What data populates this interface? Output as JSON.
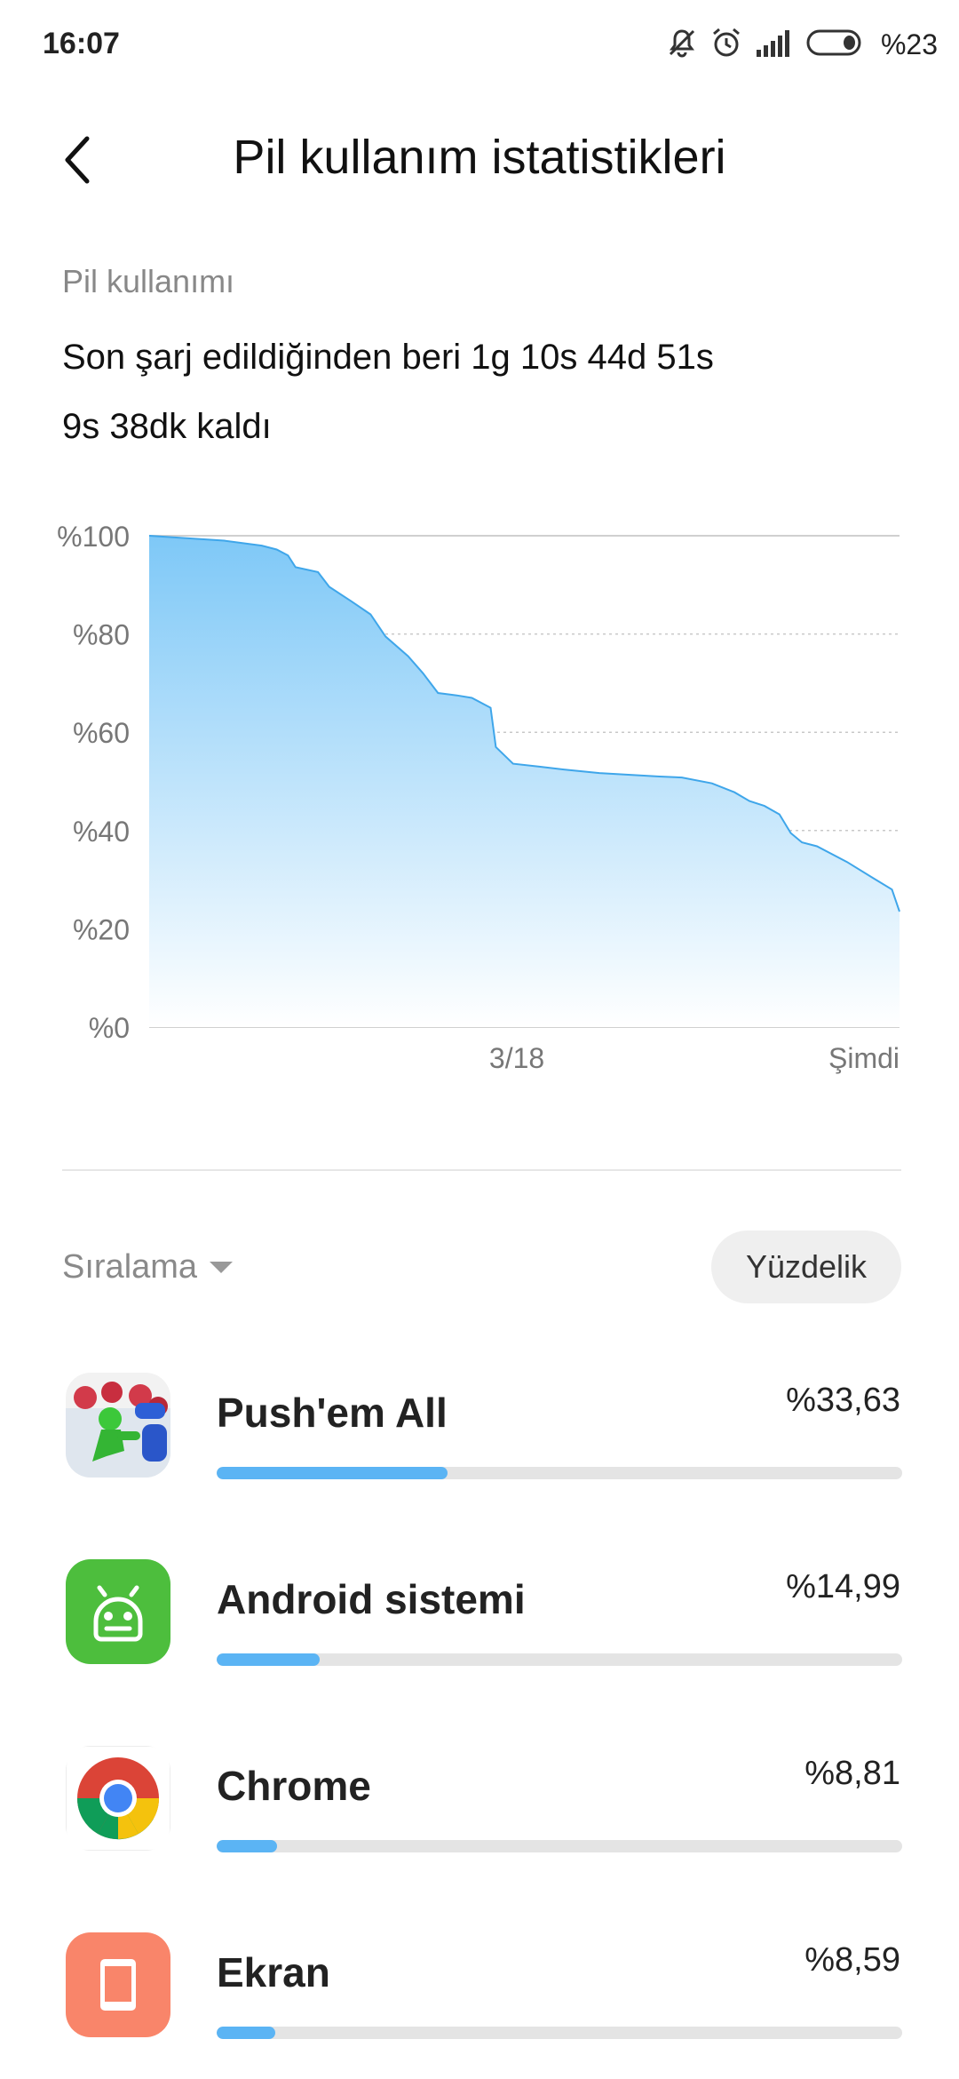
{
  "status_bar": {
    "time": "16:07",
    "battery_text": "%23",
    "icons": [
      "muted-bell-icon",
      "alarm-icon",
      "signal-icon",
      "battery-icon"
    ]
  },
  "header": {
    "title": "Pil kullanım istatistikleri",
    "back_icon": "chevron-left-icon"
  },
  "usage": {
    "section_label": "Pil kullanımı",
    "since_charge": "Son şarj edildiğinden beri 1g 10s 44d 51s",
    "remaining": "9s 38dk kaldı"
  },
  "chart_data": {
    "type": "area",
    "title": "",
    "xlabel": "",
    "ylabel": "",
    "ylim": [
      0,
      100
    ],
    "y_ticks": [
      "%100",
      "%80",
      "%60",
      "%40",
      "%20",
      "%0"
    ],
    "x_ticks": [
      {
        "label": "3/18",
        "t": 0.49
      },
      {
        "label": "Şimdi",
        "t": 1.0
      }
    ],
    "grid": true,
    "color": "#3fa6ea",
    "fill_top": "#7ec8f7",
    "series": [
      {
        "x": [
          0,
          0.05,
          0.1,
          0.15,
          0.17,
          0.185,
          0.195,
          0.225,
          0.24,
          0.27,
          0.295,
          0.315,
          0.345,
          0.365,
          0.385,
          0.41,
          0.43,
          0.455,
          0.462,
          0.485,
          0.52,
          0.56,
          0.6,
          0.68,
          0.71,
          0.75,
          0.78,
          0.8,
          0.82,
          0.84,
          0.855,
          0.87,
          0.89,
          0.93,
          0.965,
          0.99,
          1.0
        ],
        "y": [
          100,
          99.5,
          99,
          98,
          97.2,
          96,
          93.6,
          92.6,
          89.6,
          86.6,
          84,
          79.5,
          75.5,
          72,
          68,
          67.5,
          67,
          65,
          57,
          53.6,
          53,
          52.3,
          51.7,
          51,
          50.8,
          49.6,
          47.8,
          46,
          45,
          43.3,
          39.5,
          37.6,
          36.8,
          33.6,
          30.3,
          28,
          23.5
        ]
      }
    ]
  },
  "sort": {
    "label": "Sıralama",
    "percent_button": "Yüzdelik"
  },
  "apps": [
    {
      "name": "Push'em All",
      "percent": "%33,63",
      "value": 33.63,
      "icon": "pushem-all-game-icon"
    },
    {
      "name": "Android sistemi",
      "percent": "%14,99",
      "value": 14.99,
      "icon": "android-system-icon"
    },
    {
      "name": "Chrome",
      "percent": "%8,81",
      "value": 8.81,
      "icon": "chrome-icon"
    },
    {
      "name": "Ekran",
      "percent": "%8,59",
      "value": 8.59,
      "icon": "screen-icon"
    }
  ]
}
